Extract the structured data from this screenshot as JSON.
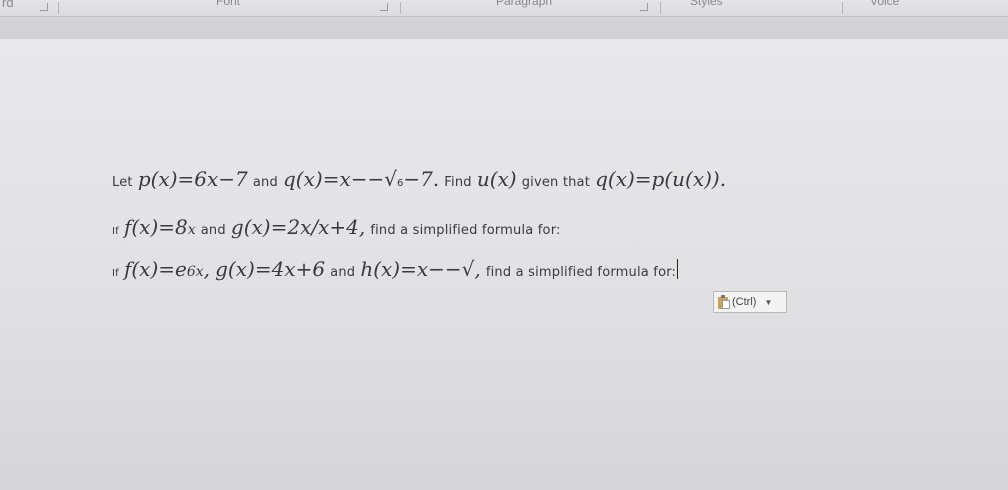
{
  "ribbon": {
    "left_fragment": "rd",
    "groups": [
      "Font",
      "Paragraph",
      "Styles",
      "Voice"
    ]
  },
  "doc": {
    "line1": {
      "let": "Let",
      "p_def": "p(x)=6x−7",
      "and": "and",
      "q_def_a": "q(x)=x−−√",
      "q_sub": "6",
      "q_def_b": "−7.",
      "find": "Find",
      "u": "u(x)",
      "given": "given that",
      "comp": "q(x)=p(u(x))."
    },
    "line2": {
      "if": "If",
      "f_def": "f(x)=8",
      "f_x": "x",
      "and": "and",
      "g_def": "g(x)=2x/x+4,",
      "rest": "find a simplified formula for:"
    },
    "line3": {
      "if": "If",
      "f_def": "f(x)=e",
      "f_exp": "6x",
      "comma": ",",
      "g_def": "g(x)=4x+6",
      "and": "and",
      "h_def": "h(x)=x−−√,",
      "rest": "find a simplified formula for:"
    }
  },
  "paste_options": {
    "label": "(Ctrl)",
    "icon": "clipboard-icon"
  }
}
